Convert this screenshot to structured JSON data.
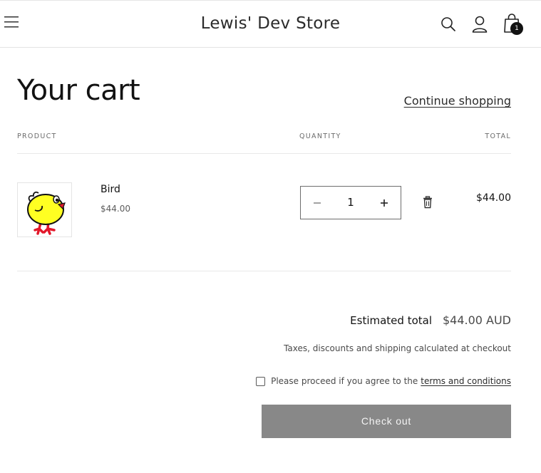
{
  "header": {
    "store_name": "Lewis' Dev Store",
    "cart_count": "1",
    "icons": [
      "menu-icon",
      "search-icon",
      "account-icon",
      "cart-icon"
    ]
  },
  "cart": {
    "title": "Your cart",
    "continue_label": "Continue shopping",
    "columns": {
      "product": "PRODUCT",
      "quantity": "QUANTITY",
      "total": "TOTAL"
    },
    "items": [
      {
        "name": "Bird",
        "unit_price": "$44.00",
        "quantity": "1",
        "line_total": "$44.00",
        "image": "yellow-chick"
      }
    ]
  },
  "summary": {
    "estimated_label": "Estimated total",
    "estimated_value": "$44.00 AUD",
    "tax_note": "Taxes, discounts and shipping calculated at checkout",
    "terms_text": "Please proceed if you agree to the",
    "terms_link": "terms and conditions",
    "checkout_label": "Check out"
  },
  "colors": {
    "checkout_button": "#888888",
    "text": "#121212",
    "divider": "#e8e8e8"
  }
}
